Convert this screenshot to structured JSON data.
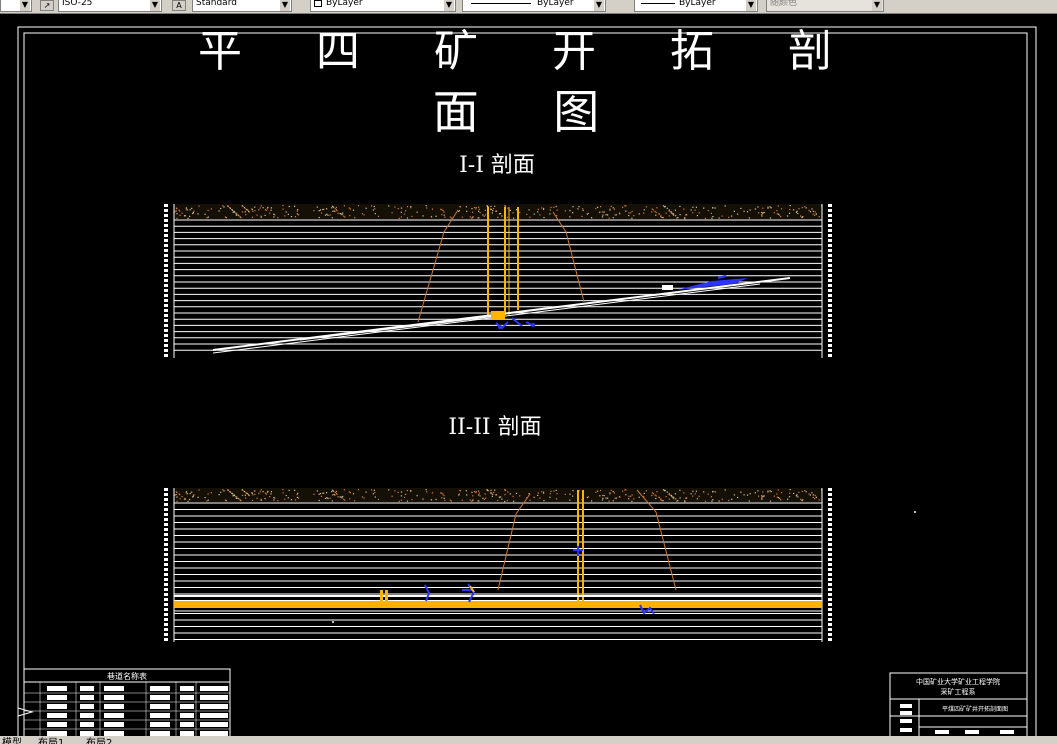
{
  "toolbar": {
    "dimstyle_value": "ISO-25",
    "textstyle_value": "Standard",
    "layer_value": "ByLayer",
    "linetype_value": "ByLayer",
    "lineweight_value": "ByLayer",
    "plotstyle_value": "随颜色"
  },
  "drawing": {
    "title_line1": "平 四 矿 开 拓 剖",
    "title_line2": "面 图",
    "section1_label": "I-I 剖面",
    "section2_label": "II-II 剖面",
    "table_title": "巷道名称表",
    "title_block": {
      "line1": "中国矿业大学矿业工程学院",
      "line2": "采矿工程系",
      "drawing_name": "平煤四矿矿井开拓剖面图"
    }
  },
  "statusbar": {
    "tabs": [
      "模型",
      "布局1",
      "布局2"
    ]
  },
  "colors": {
    "background": "#000000",
    "line_white": "#ffffff",
    "shaft_orange": "#ffb400",
    "seam_orange": "#ffb000",
    "fault_brown": "#c8783a",
    "marker_blue": "#2b35ff",
    "toolbar_grey": "#d4d0c8"
  }
}
